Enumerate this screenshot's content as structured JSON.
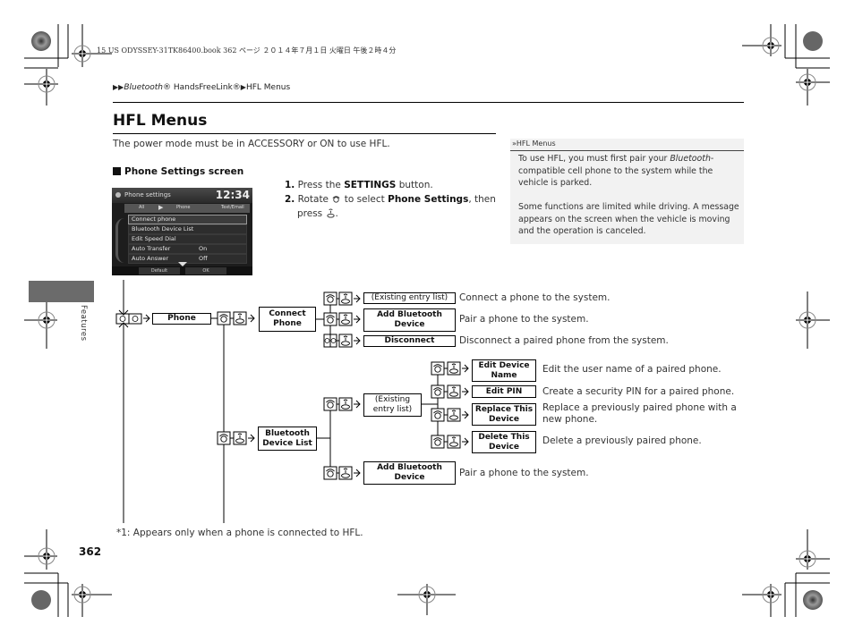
{
  "print_header": "15 US ODYSSEY-31TK86400.book  362 ページ  ２０１４年７月１日  火曜日  午後２時４分",
  "breadcrumb": {
    "arrow": "▶▶",
    "item1": "Bluetooth",
    "item1_suffix": "® HandsFreeLink®",
    "sep": "▶",
    "item2": "HFL Menus"
  },
  "page_title": "HFL Menus",
  "intro_text": "The power mode must be in ACCESSORY or ON to use HFL.",
  "section_heading": "Phone Settings screen",
  "steps": [
    {
      "num": "1.",
      "pre": "Press the ",
      "bold": "SETTINGS",
      "post": " button."
    },
    {
      "num": "2.",
      "pre": "Rotate ",
      "mid": " to select ",
      "bold": "Phone Settings",
      "post": ", then",
      "line2": "press ",
      "end": "."
    }
  ],
  "screen": {
    "title": "Phone settings",
    "time": "12:34",
    "tabs": [
      "All",
      "Phone",
      "Text/Email"
    ],
    "rows": [
      {
        "label": "Connect phone",
        "value": ""
      },
      {
        "label": "Bluetooth Device List",
        "value": ""
      },
      {
        "label": "Edit Speed Dial",
        "value": ""
      },
      {
        "label": "Auto Transfer",
        "value": "On"
      },
      {
        "label": "Auto Answer",
        "value": "Off"
      }
    ],
    "buttons": [
      "Default",
      "OK"
    ]
  },
  "side_note": {
    "heading_icon": "»",
    "heading": "HFL Menus",
    "p1_pre": "To use HFL, you must first pair your ",
    "p1_italic": "Bluetooth",
    "p1_post": "-compatible cell phone to the system while the vehicle is parked.",
    "p2": "Some functions are limited while driving. A message appears on the screen when the vehicle is moving and the operation is canceled."
  },
  "side_tab_label": "Features",
  "diagram": {
    "root": "Phone",
    "connect_phone": "Connect Phone",
    "existing_entry_list_1": "(Existing entry list)",
    "add_bt_device_1": "Add Bluetooth Device",
    "disconnect": "Disconnect",
    "bt_device_list": "Bluetooth Device List",
    "existing_entry_list_2": "(Existing entry list)",
    "edit_device_name": "Edit Device Name",
    "edit_pin": "Edit PIN",
    "replace_this_device": "Replace This Device",
    "delete_this_device": "Delete This Device",
    "add_bt_device_2": "Add Bluetooth Device",
    "descriptions": {
      "existing_entry_list_1": "Connect a phone to the system.",
      "add_bt_device_1": "Pair a phone to the system.",
      "disconnect": "Disconnect a paired phone from the system.",
      "edit_device_name": "Edit the user name of a paired phone.",
      "edit_pin": "Create a security PIN for a paired phone.",
      "replace_this_device_l1": "Replace a previously paired phone with a",
      "replace_this_device_l2": "new phone.",
      "delete_this_device": "Delete a previously paired phone.",
      "add_bt_device_2": "Pair a phone to the system."
    }
  },
  "footnote": "*1: Appears only when a phone is connected to HFL.",
  "page_number": "362"
}
